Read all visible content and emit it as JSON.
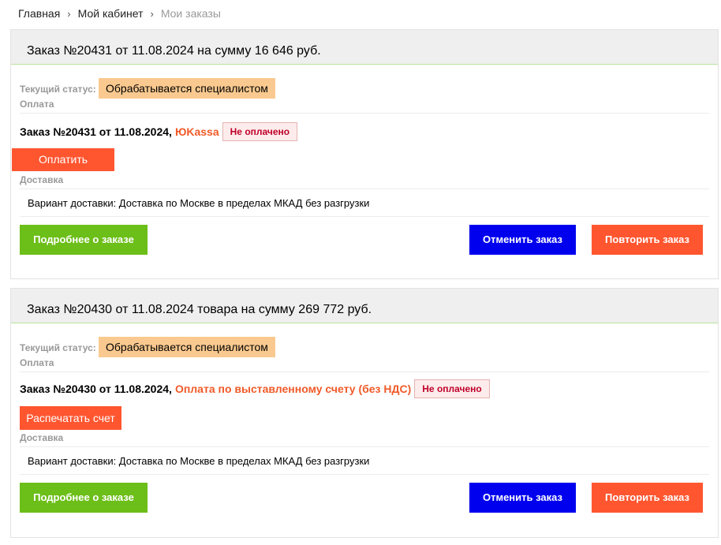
{
  "breadcrumb": {
    "home": "Главная",
    "cabinet": "Мой кабинет",
    "current": "Мои заказы"
  },
  "labels": {
    "status": "Текущий статус:",
    "payment": "Оплата",
    "delivery": "Доставка"
  },
  "orders": [
    {
      "header": "Заказ №20431 от 11.08.2024 на сумму 16 646 руб.",
      "status": "Обрабатывается специалистом",
      "payment_prefix": "Заказ №20431 от 11.08.2024,",
      "payment_method": "ЮKassa",
      "payment_state": "Не оплачено",
      "pay_action": "Оплатить",
      "delivery_variant": "Вариант доставки: Доставка по Москве в пределах МКАД без разгрузки",
      "details_btn": "Подробнее о заказе",
      "cancel_btn": "Отменить заказ",
      "repeat_btn": "Повторить заказ"
    },
    {
      "header": "Заказ №20430 от 11.08.2024 товара на сумму 269 772 руб.",
      "status": "Обрабатывается специалистом",
      "payment_prefix": "Заказ №20430 от 11.08.2024,",
      "payment_method": "Оплата по выставленному счету (без НДС)",
      "payment_state": "Не оплачено",
      "pay_action": "Распечатать счет",
      "delivery_variant": "Вариант доставки: Доставка по Москве в пределах МКАД без разгрузки",
      "details_btn": "Подробнее о заказе",
      "cancel_btn": "Отменить заказ",
      "repeat_btn": "Повторить заказ"
    }
  ]
}
